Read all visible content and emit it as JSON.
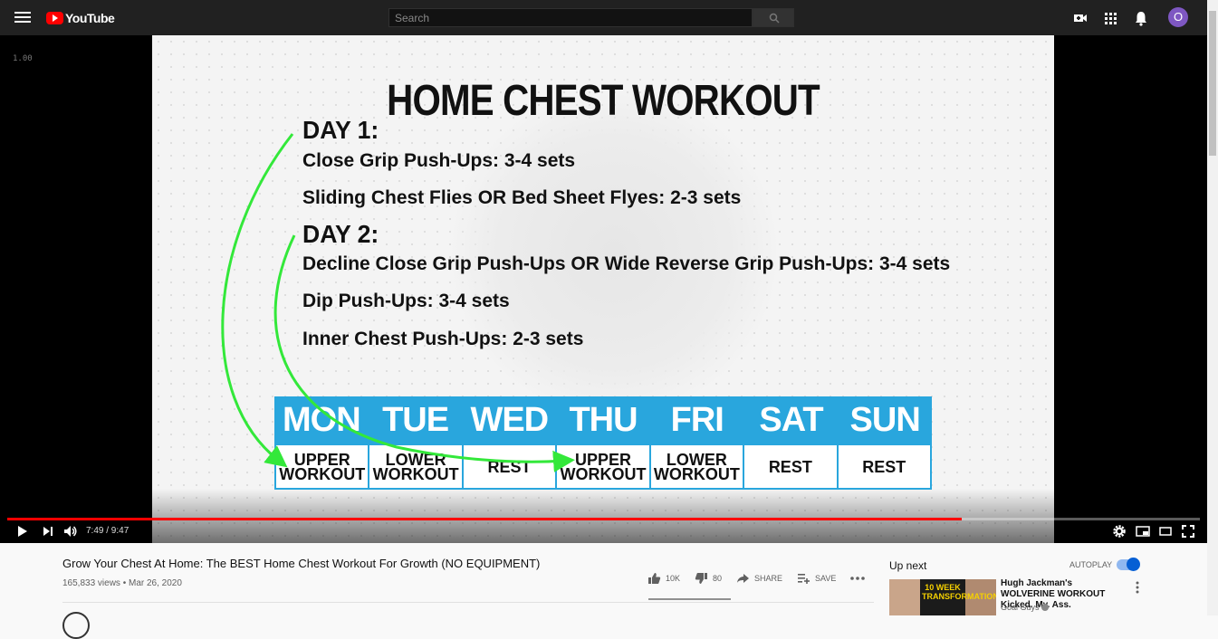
{
  "header": {
    "logo_text": "YouTube",
    "search_placeholder": "Search",
    "avatar_letter": "O"
  },
  "player": {
    "speed_label": "1.00",
    "time_display": "7:49 / 9:47",
    "progress_fraction": 0.8,
    "slide": {
      "title": "HOME CHEST WORKOUT",
      "day1_header": "DAY 1:",
      "day1_exercises": [
        "Close Grip Push-Ups: 3-4 sets",
        "Sliding Chest Flies OR Bed Sheet Flyes: 2-3 sets"
      ],
      "day2_header": "DAY 2:",
      "day2_exercises": [
        "Decline Close Grip Push-Ups OR Wide Reverse Grip Push-Ups: 3-4 sets",
        "Dip Push-Ups: 3-4 sets",
        "Inner Chest Push-Ups: 2-3 sets"
      ],
      "schedule_days": [
        "MON",
        "TUE",
        "WED",
        "THU",
        "FRI",
        "SAT",
        "SUN"
      ],
      "schedule_rows": [
        [
          "UPPER",
          "WORKOUT"
        ],
        [
          "LOWER",
          "WORKOUT"
        ],
        [
          "REST"
        ],
        [
          "UPPER",
          "WORKOUT"
        ],
        [
          "LOWER",
          "WORKOUT"
        ],
        [
          "REST"
        ],
        [
          "REST"
        ]
      ]
    }
  },
  "video": {
    "title": "Grow Your Chest At Home: The BEST Home Chest Workout For Growth (NO EQUIPMENT)",
    "meta": "165,833 views • Mar 26, 2020",
    "likes": "10K",
    "dislikes": "80",
    "share_label": "SHARE",
    "save_label": "SAVE"
  },
  "sidebar": {
    "up_next_label": "Up next",
    "autoplay_label": "AUTOPLAY",
    "autoplay_on": true,
    "recommended": [
      {
        "title": "Hugh Jackman's WOLVERINE WORKOUT Kicked. My. Ass.",
        "channel": "Goal Guys",
        "thumb_text": "10 WEEK TRANSFORMATION"
      }
    ]
  },
  "colors": {
    "accent_red": "#ff0000",
    "schedule_blue": "#29a6dd",
    "arrow_green": "#33e83a",
    "toggle_blue": "#065fd4"
  }
}
